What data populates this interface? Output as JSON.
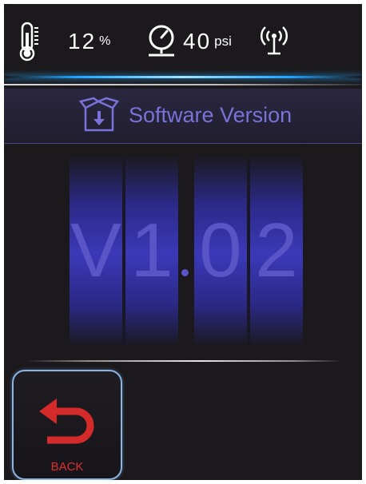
{
  "status": {
    "humidity_value": "12",
    "humidity_unit": "%",
    "pressure_value": "40",
    "pressure_unit": "psi",
    "icons": [
      "thermometer-icon",
      "pressure-gauge-icon",
      "wireless-signal-icon"
    ]
  },
  "page": {
    "title": "Software Version",
    "title_icon": "download-box-icon"
  },
  "version": {
    "digits": [
      "V",
      "1",
      "0",
      "2"
    ],
    "separator": "."
  },
  "back_button": {
    "label": "BACK",
    "icon": "back-arrow-icon"
  },
  "colors": {
    "background": "#1b191c",
    "accent_blue": "#1fa4ff",
    "title_purple": "#7a72d8",
    "digit_purple": "#5a55c6",
    "back_red": "#e02d2d",
    "button_border": "#8ab4e4"
  }
}
